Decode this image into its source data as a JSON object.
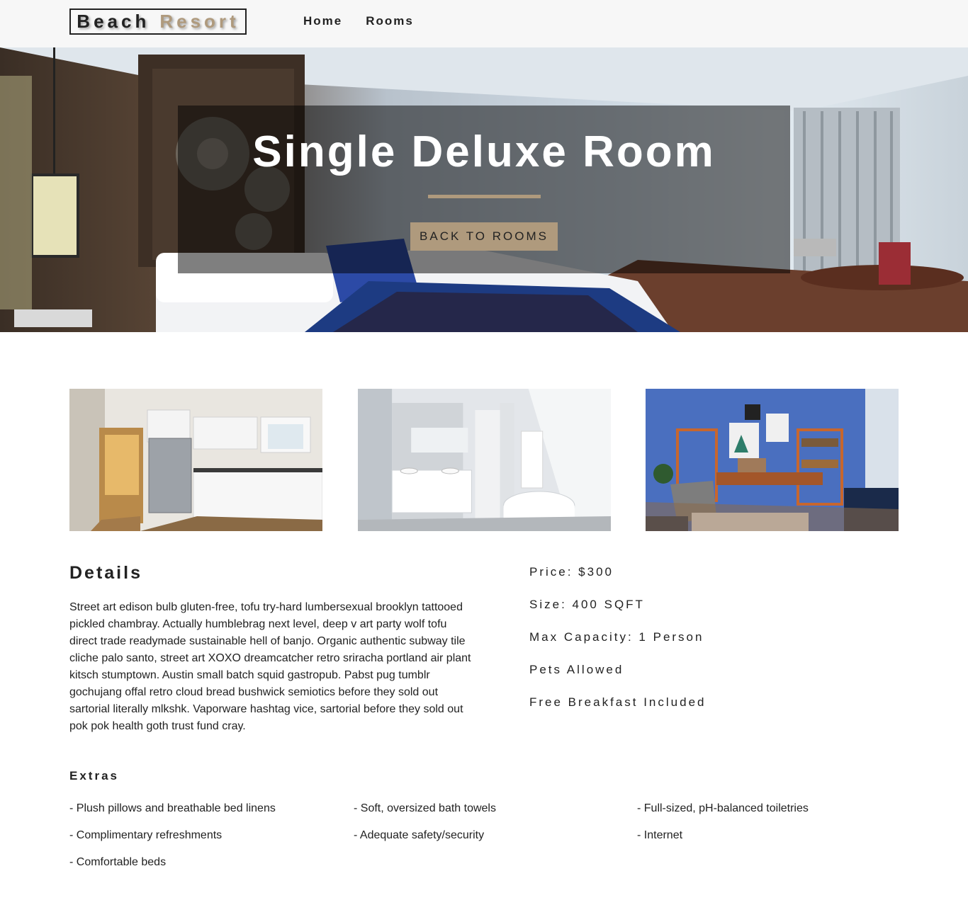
{
  "navbar": {
    "logo_part1": "Beach",
    "logo_part2": "Resort",
    "links": [
      "Home",
      "Rooms"
    ]
  },
  "hero": {
    "title": "Single Deluxe Room",
    "button_label": "BACK TO ROOMS"
  },
  "gallery": [
    {
      "name": "kitchen-image"
    },
    {
      "name": "bathroom-image"
    },
    {
      "name": "living-room-image"
    }
  ],
  "details": {
    "title": "Details",
    "description": "Street art edison bulb gluten-free, tofu try-hard lumbersexual brooklyn tattooed pickled chambray. Actually humblebrag next level, deep v art party wolf tofu direct trade readymade sustainable hell of banjo. Organic authentic subway tile cliche palo santo, street art XOXO dreamcatcher retro sriracha portland air plant kitsch stumptown. Austin small batch squid gastropub. Pabst pug tumblr gochujang offal retro cloud bread bushwick semiotics before they sold out sartorial literally mlkshk. Vaporware hashtag vice, sartorial before they sold out pok pok health goth trust fund cray."
  },
  "info": {
    "price": "Price: $300",
    "size": "Size: 400 SQFT",
    "capacity": "Max Capacity: 1 Person",
    "pets": "Pets Allowed",
    "breakfast": "Free Breakfast Included"
  },
  "extras": {
    "title": "Extras",
    "items": [
      "- Plush pillows and breathable bed linens",
      "- Soft, oversized bath towels",
      "- Full-sized, pH-balanced toiletries",
      "- Complimentary refreshments",
      "- Adequate safety/security",
      "- Internet",
      "- Comfortable beds"
    ]
  },
  "colors": {
    "accent": "#af9a7d",
    "text": "#222222",
    "navbar_bg": "#f7f7f7"
  }
}
